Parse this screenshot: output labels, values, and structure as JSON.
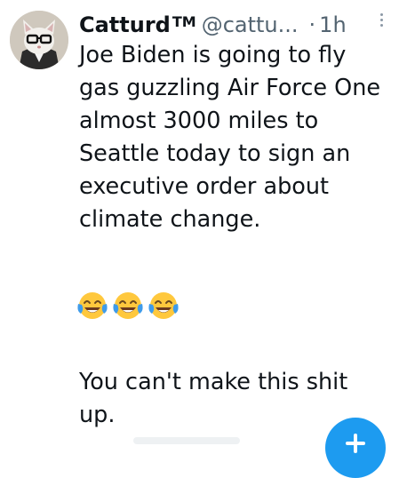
{
  "tweet": {
    "author_name": "Catturd",
    "trademark": "TM",
    "handle": "@cattu...",
    "separator": "·",
    "time": "1h",
    "text_main": "Joe Biden is going to fly\ngas guzzling Air Force One\nalmost 3000 miles to\nSeattle today to sign an\nexecutive order about\nclimate change.",
    "emojis": [
      "face-with-tears-of-joy",
      "face-with-tears-of-joy",
      "face-with-tears-of-joy"
    ],
    "text_final": "You can't make this shit\nup."
  },
  "icons": {
    "more": "more-options-icon",
    "compose": "compose-plus-icon"
  },
  "colors": {
    "text": "#0f1419",
    "secondary": "#536471",
    "accent": "#1d9bf0",
    "emoji_face": "#ffc83d"
  }
}
